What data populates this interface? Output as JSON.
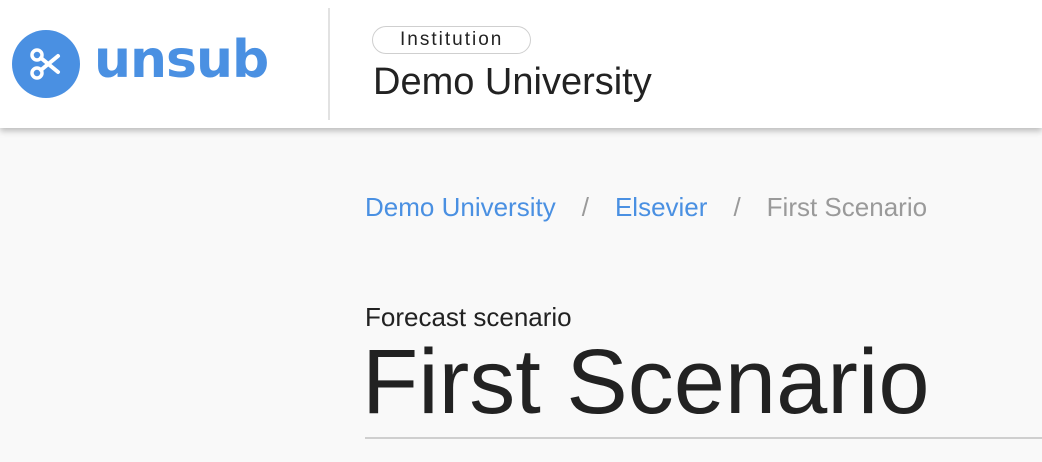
{
  "header": {
    "logo_text": "unsub",
    "logo_icon": "scissors-icon",
    "institution_chip": "Institution",
    "institution_name": "Demo University"
  },
  "breadcrumb": {
    "items": [
      {
        "label": "Demo University",
        "link": true
      },
      {
        "label": "Elsevier",
        "link": true
      },
      {
        "label": "First Scenario",
        "link": false
      }
    ],
    "separator": "/"
  },
  "main": {
    "subtitle": "Forecast scenario",
    "title": "First Scenario"
  },
  "colors": {
    "brand": "#4a90e2",
    "text": "#222222",
    "muted": "#9a9a9a",
    "background": "#f9f9f9"
  }
}
